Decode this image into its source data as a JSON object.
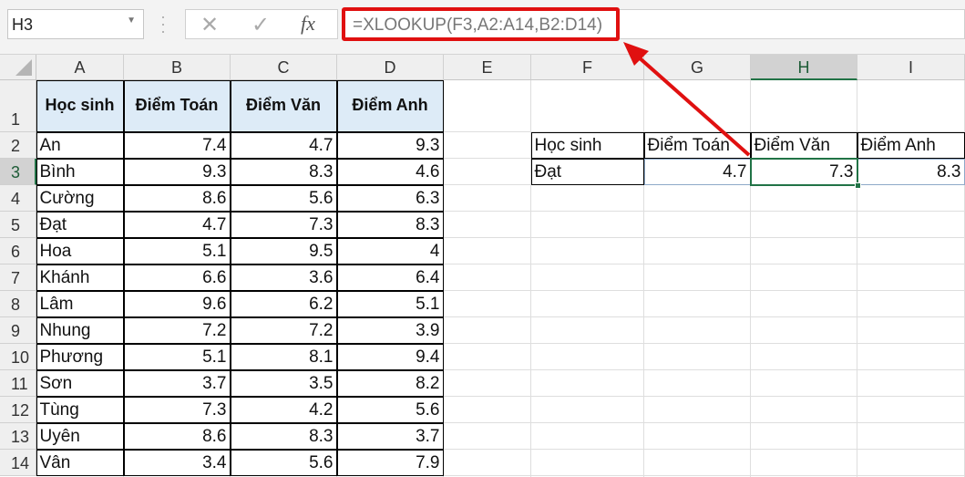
{
  "name_box": "H3",
  "formula_bar": {
    "cancel_icon": "✕",
    "enter_icon": "✓",
    "fx_label": "fx",
    "formula": "=XLOOKUP(F3,A2:A14,B2:D14)"
  },
  "columns": [
    "A",
    "B",
    "C",
    "D",
    "E",
    "F",
    "G",
    "H",
    "I"
  ],
  "rows": [
    "1",
    "2",
    "3",
    "4",
    "5",
    "6",
    "7",
    "8",
    "9",
    "10",
    "11",
    "12",
    "13",
    "14"
  ],
  "selected": {
    "column": "H",
    "row": "3"
  },
  "table": {
    "headers": [
      "Học sinh",
      "Điểm Toán",
      "Điểm Văn",
      "Điểm Anh"
    ],
    "data": [
      [
        "An",
        "7.4",
        "4.7",
        "9.3"
      ],
      [
        "Bình",
        "9.3",
        "8.3",
        "4.6"
      ],
      [
        "Cường",
        "8.6",
        "5.6",
        "6.3"
      ],
      [
        "Đạt",
        "4.7",
        "7.3",
        "8.3"
      ],
      [
        "Hoa",
        "5.1",
        "9.5",
        "4"
      ],
      [
        "Khánh",
        "6.6",
        "3.6",
        "6.4"
      ],
      [
        "Lâm",
        "9.6",
        "6.2",
        "5.1"
      ],
      [
        "Nhung",
        "7.2",
        "7.2",
        "3.9"
      ],
      [
        "Phương",
        "5.1",
        "8.1",
        "9.4"
      ],
      [
        "Sơn",
        "3.7",
        "3.5",
        "8.2"
      ],
      [
        "Tùng",
        "7.3",
        "4.2",
        "5.6"
      ],
      [
        "Uyên",
        "8.6",
        "8.3",
        "3.7"
      ],
      [
        "Vân",
        "3.4",
        "5.6",
        "7.9"
      ]
    ]
  },
  "lookup": {
    "headers": [
      "Học sinh",
      "Điểm Toán",
      "Điểm Văn",
      "Điểm Anh"
    ],
    "values": [
      "Đạt",
      "4.7",
      "7.3",
      "8.3"
    ]
  },
  "annotation_color": "#e01010"
}
